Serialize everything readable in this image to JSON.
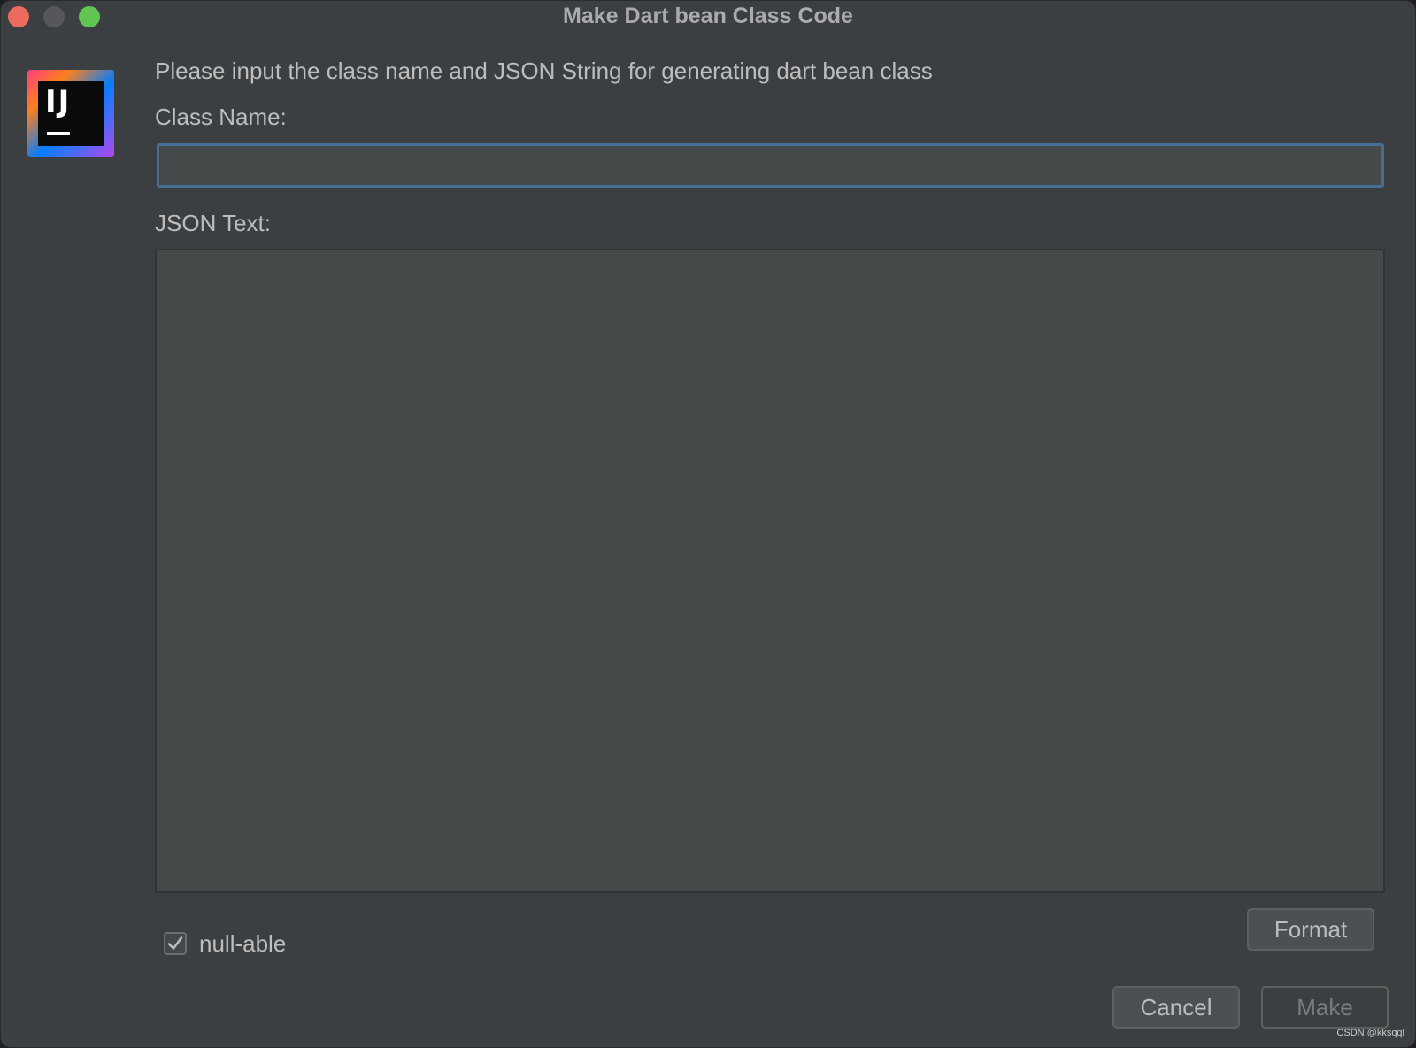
{
  "window": {
    "title": "Make Dart bean Class Code"
  },
  "logo": {
    "text": "IJ"
  },
  "form": {
    "prompt": "Please input the class name and JSON String for generating dart bean class",
    "class_name_label": "Class Name:",
    "class_name_value": "",
    "json_label": "JSON Text:",
    "json_value": "",
    "nullable_label": "null-able",
    "nullable_checked": true
  },
  "buttons": {
    "format": "Format",
    "cancel": "Cancel",
    "make": "Make"
  },
  "watermark": "CSDN @kksqql",
  "colors": {
    "background": "#3c3f41",
    "input_focus_border": "#466d94",
    "close": "#ed6a5e",
    "minimize": "#55575a",
    "maximize": "#61c554"
  }
}
